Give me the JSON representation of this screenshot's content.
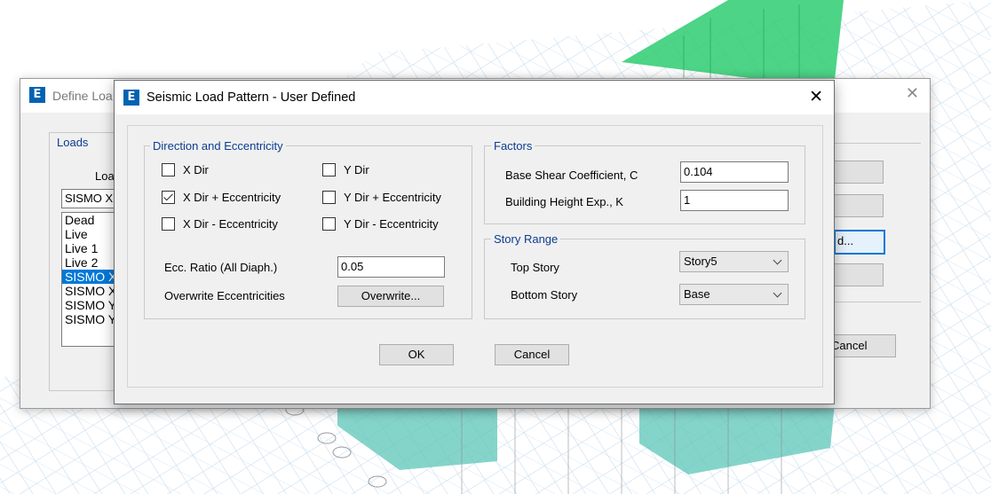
{
  "background_dialog": {
    "title": "Define Loa",
    "close_glyph": "✕",
    "app_icon": "E",
    "loads_group_label": "Loads",
    "load_column_label": "Loa",
    "load_name_value": "SISMO X",
    "load_list": [
      {
        "label": "Dead",
        "selected": false
      },
      {
        "label": "Live",
        "selected": false
      },
      {
        "label": "Live 1",
        "selected": false
      },
      {
        "label": "Live 2",
        "selected": false
      },
      {
        "label": "SISMO X",
        "selected": true
      },
      {
        "label": "SISMO X",
        "selected": false
      },
      {
        "label": "SISMO Y",
        "selected": false
      },
      {
        "label": "SISMO Y",
        "selected": false
      }
    ],
    "modify_button_label": "d...",
    "cancel_button_label": "Cancel"
  },
  "dialog": {
    "app_icon": "E",
    "title": "Seismic Load Pattern - User Defined",
    "close_glyph": "✕",
    "direction_group": {
      "label": "Direction and Eccentricity",
      "options": {
        "x_dir": {
          "label": "X Dir",
          "checked": false
        },
        "x_dir_plus": {
          "label": "X Dir + Eccentricity",
          "checked": true
        },
        "x_dir_minus": {
          "label": "X Dir - Eccentricity",
          "checked": false
        },
        "y_dir": {
          "label": "Y Dir",
          "checked": false
        },
        "y_dir_plus": {
          "label": "Y Dir + Eccentricity",
          "checked": false
        },
        "y_dir_minus": {
          "label": "Y Dir - Eccentricity",
          "checked": false
        }
      },
      "ecc_ratio_label": "Ecc. Ratio (All Diaph.)",
      "ecc_ratio_value": "0.05",
      "overwrite_label": "Overwrite Eccentricities",
      "overwrite_button": "Overwrite..."
    },
    "factors_group": {
      "label": "Factors",
      "base_shear_label": "Base Shear Coefficient, C",
      "base_shear_value": "0.104",
      "height_exp_label": "Building Height Exp., K",
      "height_exp_value": "1"
    },
    "story_range_group": {
      "label": "Story Range",
      "top_story_label": "Top Story",
      "top_story_value": "Story5",
      "bottom_story_label": "Bottom Story",
      "bottom_story_value": "Base"
    },
    "ok_button": "OK",
    "cancel_button": "Cancel"
  },
  "colors": {
    "accent": "#0078d7",
    "group_label": "#0b3d91",
    "structure_green": "#2ecc71",
    "structure_teal": "#5cc6b8",
    "grid_blue": "#b9d4ea"
  }
}
